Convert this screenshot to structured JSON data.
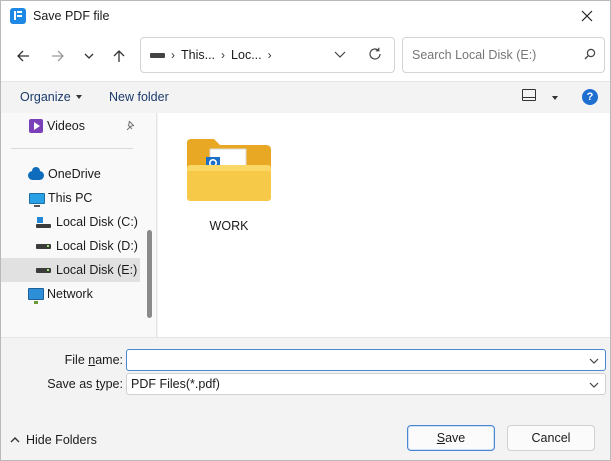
{
  "window": {
    "title": "Save PDF file"
  },
  "address": {
    "crumbs": [
      "This...",
      "Loc..."
    ]
  },
  "search": {
    "placeholder": "Search Local Disk (E:)"
  },
  "commands": {
    "organize": "Organize",
    "new_folder": "New folder",
    "help": "?"
  },
  "sidebar": {
    "items": [
      {
        "label": "Videos",
        "icon": "videos-icon"
      },
      {
        "label": "OneDrive",
        "icon": "cloud-icon"
      },
      {
        "label": "This PC",
        "icon": "computer-icon"
      },
      {
        "label": "Local Disk (C:)",
        "icon": "windows-drive-icon"
      },
      {
        "label": "Local Disk (D:)",
        "icon": "drive-icon"
      },
      {
        "label": "Local Disk (E:)",
        "icon": "drive-icon",
        "selected": true
      },
      {
        "label": "Network",
        "icon": "network-icon"
      }
    ]
  },
  "content": {
    "folders": [
      {
        "name": "WORK",
        "icon": "folder-icon"
      }
    ]
  },
  "form": {
    "file_name_label_pre": "File ",
    "file_name_label_key": "n",
    "file_name_label_post": "ame:",
    "file_name_value": "",
    "save_type_label_pre": "Save as ",
    "save_type_label_key": "t",
    "save_type_label_post": "ype:",
    "save_type_value": "PDF Files(*.pdf)"
  },
  "footer": {
    "hide_folders": "Hide Folders",
    "save_pre": "",
    "save_key": "S",
    "save_post": "ave",
    "cancel": "Cancel"
  },
  "colors": {
    "accent": "#1f6fd1",
    "folder": "#f5c440",
    "selection": "#e1e1e1"
  }
}
